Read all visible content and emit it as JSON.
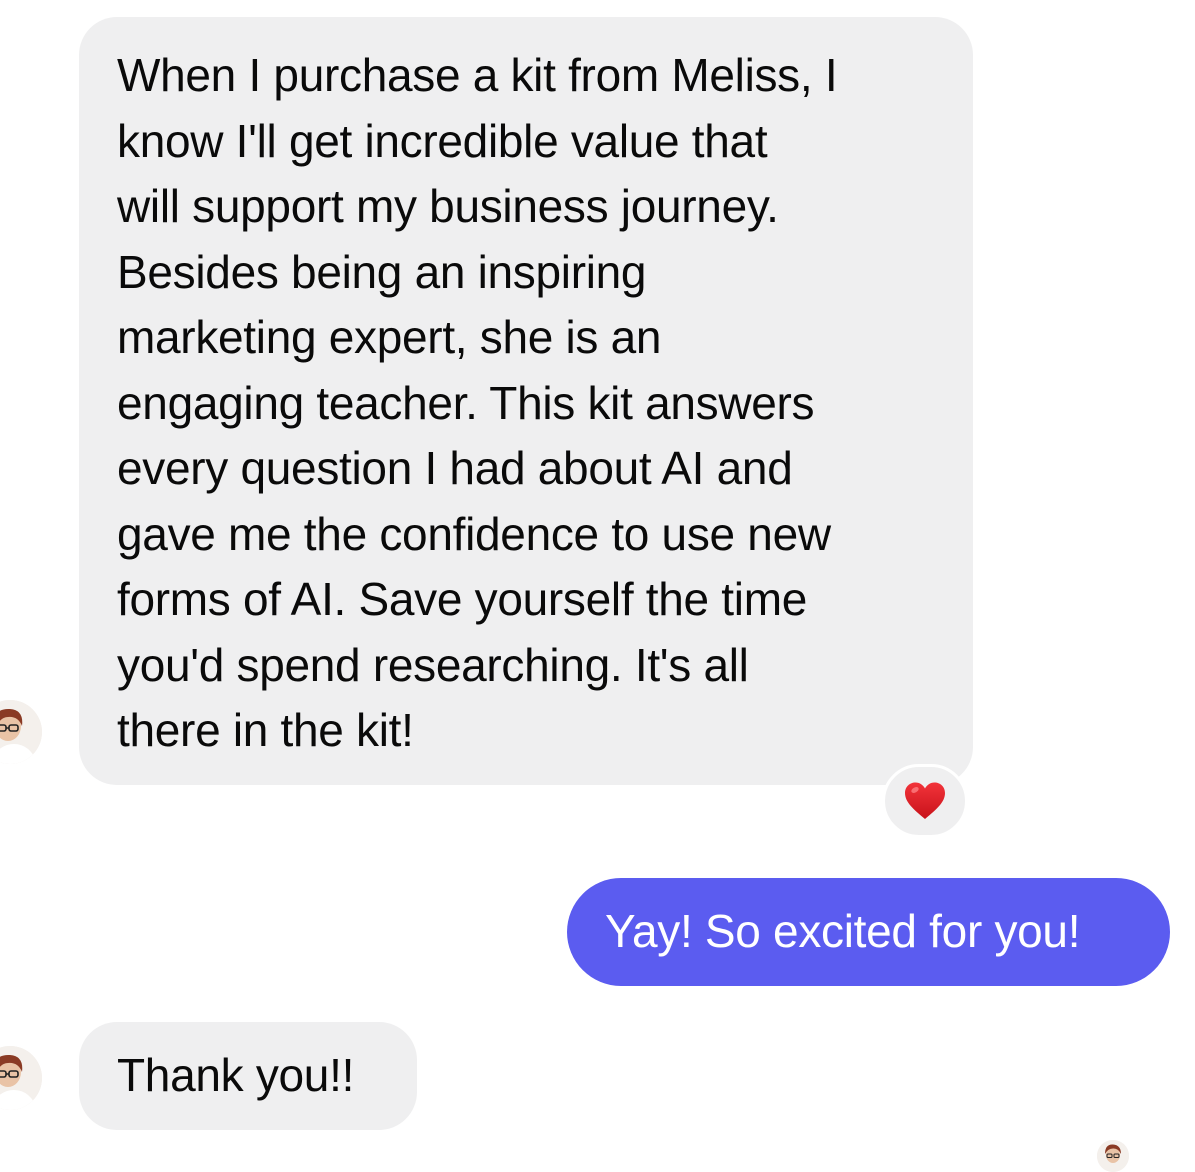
{
  "colors": {
    "incoming_bubble": "#efeff0",
    "outgoing_bubble": "#5b5cf0",
    "outgoing_text": "#ffffff",
    "reaction_heart": "#e3191f"
  },
  "conversation": {
    "messages": [
      {
        "sender": "them",
        "lines": [
          "When I purchase a kit from Meliss, I",
          "know I'll get incredible value that",
          "will support my business journey.",
          "Besides being an inspiring",
          "marketing expert, she is an",
          "engaging teacher. This kit answers",
          "every question I had about AI and",
          "gave me the confidence to use new",
          "forms of AI. Save yourself the time",
          "you'd spend researching. It's all",
          "there in the kit!"
        ],
        "reaction": "heart-icon"
      },
      {
        "sender": "me",
        "text": "Yay! So excited for you!"
      },
      {
        "sender": "them",
        "text": "Thank you!!"
      }
    ]
  }
}
